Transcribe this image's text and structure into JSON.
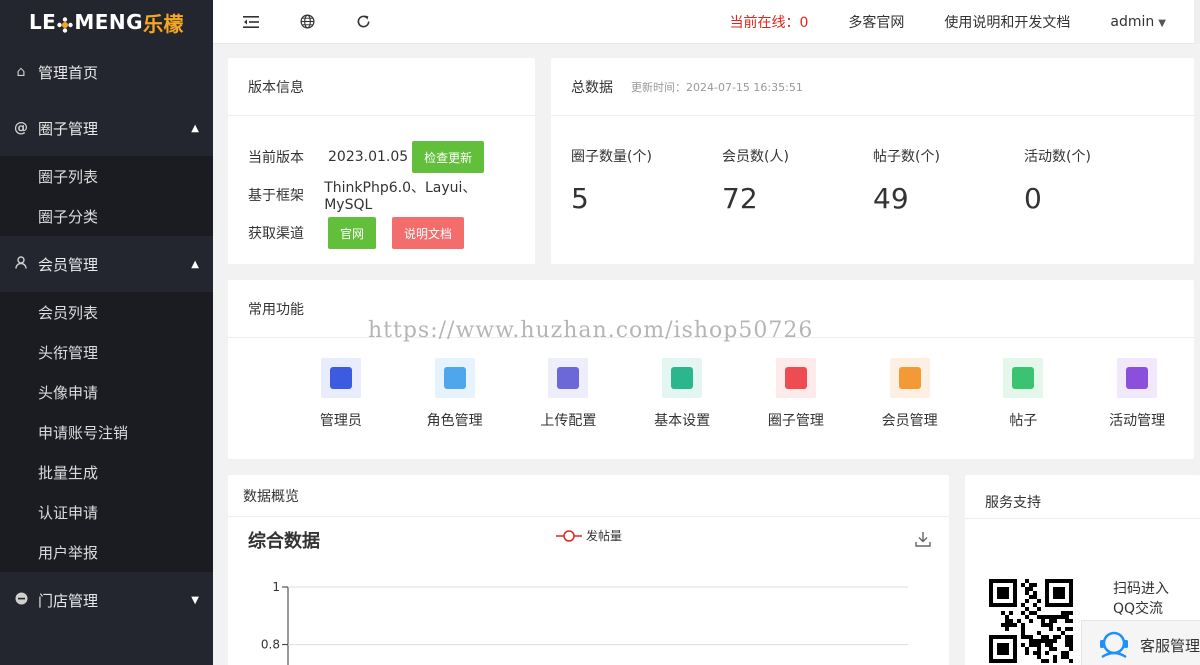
{
  "logo": {
    "latin_a": "LE",
    "latin_b": "MENG",
    "chinese": "乐檬"
  },
  "sidebar": {
    "home": "管理首页",
    "circle": {
      "label": "圈子管理",
      "items": [
        "圈子列表",
        "圈子分类"
      ]
    },
    "member": {
      "label": "会员管理",
      "items": [
        "会员列表",
        "头衔管理",
        "头像申请",
        "申请账号注销",
        "批量生成",
        "认证申请",
        "用户举报"
      ]
    },
    "store": {
      "label": "门店管理"
    }
  },
  "header": {
    "online_label": "当前在线：",
    "online_count": "0",
    "official_site": "多客官网",
    "docs": "使用说明和开发文档",
    "user": "admin"
  },
  "version_card": {
    "title": "版本信息",
    "current_label": "当前版本",
    "current_value": "2023.01.05",
    "check_update": "检查更新",
    "framework_label": "基于框架",
    "framework_value": "ThinkPhp6.0、Layui、MySQL",
    "channel_label": "获取渠道",
    "official_btn": "官网",
    "docs_btn": "说明文档"
  },
  "total_card": {
    "title": "总数据",
    "updated": "更新时间：2024-07-15 16:35:51",
    "stats": [
      {
        "label": "圈子数量(个)",
        "value": "5"
      },
      {
        "label": "会员数(人)",
        "value": "72"
      },
      {
        "label": "帖子数(个)",
        "value": "49"
      },
      {
        "label": "活动数(个)",
        "value": "0"
      }
    ]
  },
  "functions_card": {
    "title": "常用功能",
    "items": [
      {
        "label": "管理员",
        "icon": "admin-icon",
        "bg": "#e9ecfd",
        "fg": "#3d5be0"
      },
      {
        "label": "角色管理",
        "icon": "role-icon",
        "bg": "#e6f3fd",
        "fg": "#4ea6ec"
      },
      {
        "label": "上传配置",
        "icon": "upload-config-icon",
        "bg": "#eeeefb",
        "fg": "#6c68d8"
      },
      {
        "label": "基本设置",
        "icon": "settings-book-icon",
        "bg": "#e3f6f1",
        "fg": "#2cb68e"
      },
      {
        "label": "圈子管理",
        "icon": "circle-manage-icon",
        "bg": "#fdeaea",
        "fg": "#ef4b52"
      },
      {
        "label": "会员管理",
        "icon": "member-code-icon",
        "bg": "#fdf0e3",
        "fg": "#f39a36"
      },
      {
        "label": "帖子",
        "icon": "post-bag-icon",
        "bg": "#e3f7ea",
        "fg": "#3cc372"
      },
      {
        "label": "活动管理",
        "icon": "activity-icon",
        "bg": "#f1e9fb",
        "fg": "#8c4fdc"
      }
    ]
  },
  "watermark": "https://www.huzhan.com/ishop50726",
  "overview_card": {
    "title": "数据概览",
    "chart_title": "综合数据",
    "legend": "发帖量",
    "y_ticks": [
      "1",
      "0.8"
    ]
  },
  "chart_data": {
    "type": "line",
    "title": "综合数据",
    "series": [
      {
        "name": "发帖量",
        "values": []
      }
    ],
    "y_ticks": [
      1,
      0.8
    ],
    "ylim": [
      0,
      1
    ],
    "grid": true,
    "legend": "top-center"
  },
  "service_card": {
    "title": "服务支持",
    "qr_text_1": "扫码进入",
    "qr_text_2": "QQ交流",
    "kefu": "客服管理"
  },
  "colors": {
    "sidebar": "#23262e",
    "accent_red": "#e0261a",
    "btn_green": "#62bf3b",
    "btn_red": "#f36d6d"
  }
}
